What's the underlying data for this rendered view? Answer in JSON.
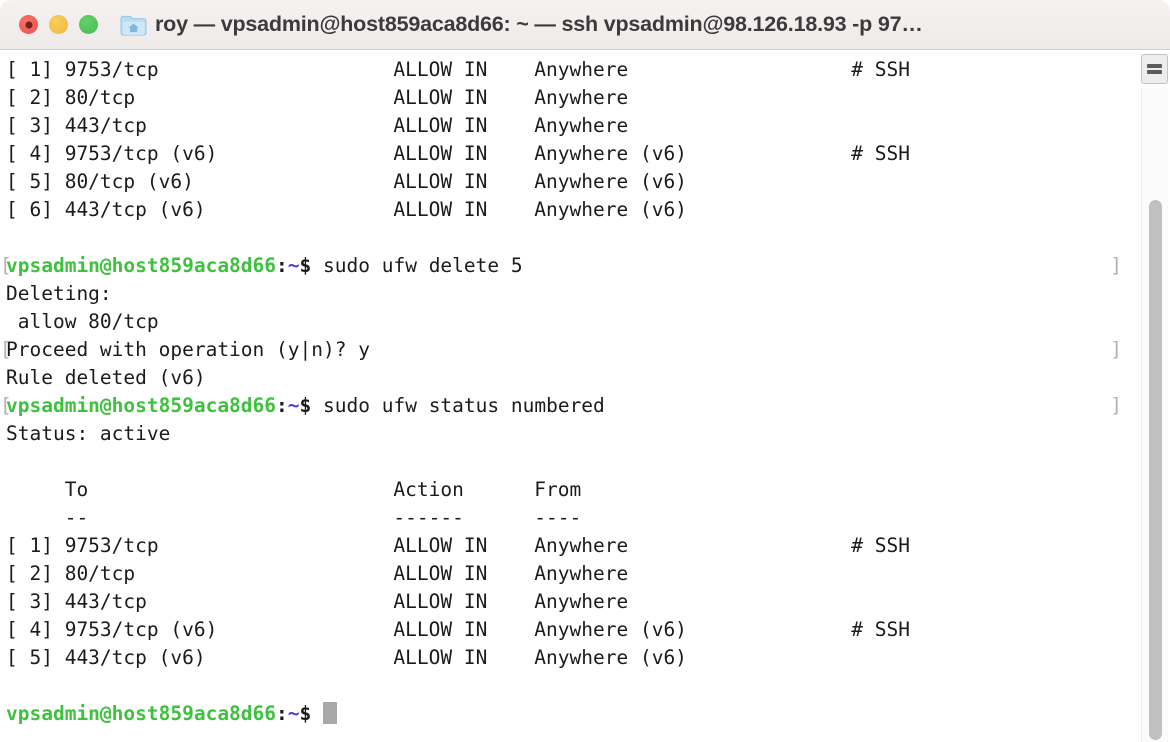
{
  "window": {
    "title": "roy — vpsadmin@host859aca8d66: ~ — ssh vpsadmin@98.126.18.93 -p 97…",
    "folder_icon": "home-folder-icon",
    "traffic_lights": {
      "close": "close-window-button",
      "minimize": "minimize-window-button",
      "maximize": "maximize-window-button"
    },
    "split_button_icon": "split-pane-icon",
    "colors": {
      "titlebar_bg": "#f3efee",
      "close": "#e8564c",
      "minimize": "#eeb83e",
      "maximize": "#45bd4e",
      "prompt_green": "#3ec13e",
      "prompt_tilde_blue": "#4a3ed6",
      "mark_gray": "#b2b2b2",
      "cursor_gray": "#a8a8a8",
      "terminal_bg": "#ffffff",
      "terminal_fg": "#1b1b1b"
    }
  },
  "prompt": {
    "user_host": "vpsadmin@host859aca8d66",
    "colon": ":",
    "tilde": "~",
    "dollar": "$",
    "mark_open": "[",
    "mark_close": "]"
  },
  "terminal": {
    "lines": [
      {
        "kind": "out",
        "text": "[ 1] 9753/tcp                    ALLOW IN    Anywhere                   # SSH"
      },
      {
        "kind": "out",
        "text": "[ 2] 80/tcp                      ALLOW IN    Anywhere"
      },
      {
        "kind": "out",
        "text": "[ 3] 443/tcp                     ALLOW IN    Anywhere"
      },
      {
        "kind": "out",
        "text": "[ 4] 9753/tcp (v6)               ALLOW IN    Anywhere (v6)              # SSH"
      },
      {
        "kind": "out",
        "text": "[ 5] 80/tcp (v6)                 ALLOW IN    Anywhere (v6)"
      },
      {
        "kind": "out",
        "text": "[ 6] 443/tcp (v6)                ALLOW IN    Anywhere (v6)"
      },
      {
        "kind": "blank",
        "text": ""
      },
      {
        "kind": "prompt",
        "command": "sudo ufw delete 5",
        "mark": true
      },
      {
        "kind": "out",
        "text": "Deleting:"
      },
      {
        "kind": "out",
        "text": " allow 80/tcp"
      },
      {
        "kind": "out",
        "text": "Proceed with operation (y|n)? y",
        "mark": true
      },
      {
        "kind": "out",
        "text": "Rule deleted (v6)"
      },
      {
        "kind": "prompt",
        "command": "sudo ufw status numbered",
        "mark": true
      },
      {
        "kind": "out",
        "text": "Status: active"
      },
      {
        "kind": "blank",
        "text": ""
      },
      {
        "kind": "out",
        "text": "     To                          Action      From"
      },
      {
        "kind": "out",
        "text": "     --                          ------      ----"
      },
      {
        "kind": "out",
        "text": "[ 1] 9753/tcp                    ALLOW IN    Anywhere                   # SSH"
      },
      {
        "kind": "out",
        "text": "[ 2] 80/tcp                      ALLOW IN    Anywhere"
      },
      {
        "kind": "out",
        "text": "[ 3] 443/tcp                     ALLOW IN    Anywhere"
      },
      {
        "kind": "out",
        "text": "[ 4] 9753/tcp (v6)               ALLOW IN    Anywhere (v6)              # SSH"
      },
      {
        "kind": "out",
        "text": "[ 5] 443/tcp (v6)                ALLOW IN    Anywhere (v6)"
      },
      {
        "kind": "blank",
        "text": ""
      },
      {
        "kind": "prompt_cursor",
        "command": "",
        "mark": false
      }
    ],
    "table": {
      "headers": [
        "To",
        "Action",
        "From"
      ],
      "underlines": [
        "--",
        "------",
        "----"
      ],
      "rows_before": [
        {
          "num": "[ 1]",
          "to": "9753/tcp",
          "action": "ALLOW IN",
          "from": "Anywhere",
          "comment": "# SSH"
        },
        {
          "num": "[ 2]",
          "to": "80/tcp",
          "action": "ALLOW IN",
          "from": "Anywhere",
          "comment": ""
        },
        {
          "num": "[ 3]",
          "to": "443/tcp",
          "action": "ALLOW IN",
          "from": "Anywhere",
          "comment": ""
        },
        {
          "num": "[ 4]",
          "to": "9753/tcp (v6)",
          "action": "ALLOW IN",
          "from": "Anywhere (v6)",
          "comment": "# SSH"
        },
        {
          "num": "[ 5]",
          "to": "80/tcp (v6)",
          "action": "ALLOW IN",
          "from": "Anywhere (v6)",
          "comment": ""
        },
        {
          "num": "[ 6]",
          "to": "443/tcp (v6)",
          "action": "ALLOW IN",
          "from": "Anywhere (v6)",
          "comment": ""
        }
      ],
      "rows_after": [
        {
          "num": "[ 1]",
          "to": "9753/tcp",
          "action": "ALLOW IN",
          "from": "Anywhere",
          "comment": "# SSH"
        },
        {
          "num": "[ 2]",
          "to": "80/tcp",
          "action": "ALLOW IN",
          "from": "Anywhere",
          "comment": ""
        },
        {
          "num": "[ 3]",
          "to": "443/tcp",
          "action": "ALLOW IN",
          "from": "Anywhere",
          "comment": ""
        },
        {
          "num": "[ 4]",
          "to": "9753/tcp (v6)",
          "action": "ALLOW IN",
          "from": "Anywhere (v6)",
          "comment": "# SSH"
        },
        {
          "num": "[ 5]",
          "to": "443/tcp (v6)",
          "action": "ALLOW IN",
          "from": "Anywhere (v6)",
          "comment": ""
        }
      ],
      "status": "Status: active",
      "deleting_header": "Deleting:",
      "deleting_rule": " allow 80/tcp",
      "confirm": "Proceed with operation (y|n)? y",
      "result": "Rule deleted (v6)"
    },
    "commands": [
      "sudo ufw delete 5",
      "sudo ufw status numbered"
    ]
  }
}
